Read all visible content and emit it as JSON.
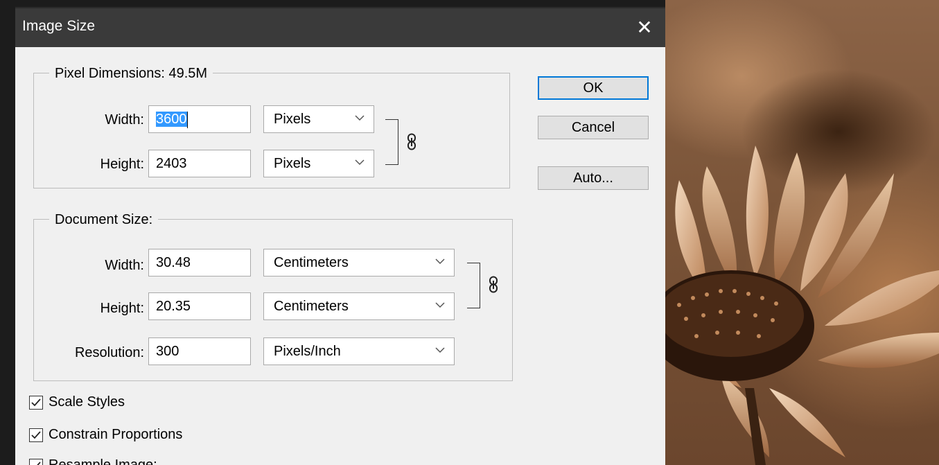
{
  "dialog": {
    "title": "Image Size",
    "close_icon": "close-icon"
  },
  "pixel_dimensions": {
    "legend": "Pixel Dimensions:  49.5M",
    "width_label": "Width:",
    "width_value": "3600",
    "width_unit": "Pixels",
    "height_label": "Height:",
    "height_value": "2403",
    "height_unit": "Pixels"
  },
  "document_size": {
    "legend": "Document Size:",
    "width_label": "Width:",
    "width_value": "30.48",
    "width_unit": "Centimeters",
    "height_label": "Height:",
    "height_value": "20.35",
    "height_unit": "Centimeters",
    "resolution_label": "Resolution:",
    "resolution_value": "300",
    "resolution_unit": "Pixels/Inch"
  },
  "buttons": {
    "ok": "OK",
    "cancel": "Cancel",
    "auto": "Auto..."
  },
  "options": {
    "scale_styles": {
      "label": "Scale Styles",
      "checked": true
    },
    "constrain_proportions": {
      "label": "Constrain Proportions",
      "checked": true
    },
    "resample_image": {
      "label": "Resample Image:",
      "checked": true
    }
  },
  "colors": {
    "titlebar": "#3a3a3a",
    "dialog_bg": "#f0f0f0",
    "selection": "#3399ff",
    "default_button_border": "#0078d7"
  }
}
